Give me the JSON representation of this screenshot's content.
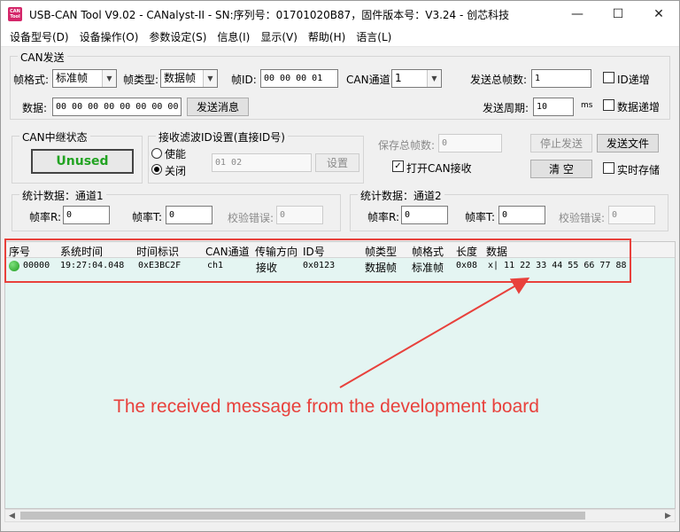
{
  "window": {
    "title": "USB-CAN Tool V9.02 - CANalyst-II - SN:序列号：01701020B87，固件版本号：V3.24 - 创芯科技",
    "icon_text": "CAN Tool",
    "icon_name": "app-icon",
    "controls": [
      "—",
      "☐",
      "✕"
    ]
  },
  "menu": [
    "设备型号(D)",
    "设备操作(O)",
    "参数设定(S)",
    "信息(I)",
    "显示(V)",
    "帮助(H)",
    "语言(L)"
  ],
  "can_send": {
    "group_title": "CAN发送",
    "frame_format_label": "帧格式:",
    "frame_format_value": "标准帧",
    "frame_type_label": "帧类型:",
    "frame_type_value": "数据帧",
    "frame_id_label": "帧ID:",
    "frame_id_value": "00 00 00 01",
    "channel_label": "CAN通道:",
    "channel_value": "1",
    "total_frames_label": "发送总帧数:",
    "total_frames_value": "1",
    "id_increment_label": "ID递增",
    "data_label": "数据:",
    "data_value": "00 00 00 00 00 00 00 00",
    "send_button": "发送消息",
    "period_label": "发送周期:",
    "period_value": "10",
    "period_unit": "ms",
    "data_increment_label": "数据递增"
  },
  "relay": {
    "group_title": "CAN中继状态",
    "status": "Unused",
    "status_color": "#22a322"
  },
  "filter": {
    "group_title": "接收滤波ID设置(直接ID号)",
    "enable_label": "使能",
    "disable_label": "关闭",
    "selected": "关闭",
    "id_value": "01 02",
    "set_button": "设置"
  },
  "save": {
    "saved_frames_label": "保存总帧数:",
    "saved_frames_value": "0",
    "stop_button": "停止发送",
    "send_file_button": "发送文件",
    "open_receive_label": "打开CAN接收",
    "open_receive_checked": true,
    "clear_button": "清 空",
    "realtime_save_label": "实时存储"
  },
  "stats1": {
    "group_title": "统计数据：通道1",
    "rx_label": "帧率R:",
    "rx_value": "0",
    "tx_label": "帧率T:",
    "tx_value": "0",
    "err_label": "校验错误:",
    "err_value": "0"
  },
  "stats2": {
    "group_title": "统计数据：通道2",
    "rx_label": "帧率R:",
    "rx_value": "0",
    "tx_label": "帧率T:",
    "tx_value": "0",
    "err_label": "校验错误:",
    "err_value": "0"
  },
  "table": {
    "headers": [
      "序号",
      "系统时间",
      "时间标识",
      "CAN通道",
      "传输方向",
      "ID号",
      "帧类型",
      "帧格式",
      "长度",
      "数据"
    ],
    "rows": [
      {
        "index": "00000",
        "sys_time": "19:27:04.048",
        "timestamp": "0xE3BC2F",
        "channel": "ch1",
        "direction": "接收",
        "id": "0x0123",
        "frame_type": "数据帧",
        "frame_format": "标准帧",
        "length": "0x08",
        "data": "x| 11 22 33 44 55 66 77 88",
        "status_color": "#22a322"
      }
    ]
  },
  "annotation": {
    "text": "The received message from the development board",
    "color": "#e8413c"
  }
}
